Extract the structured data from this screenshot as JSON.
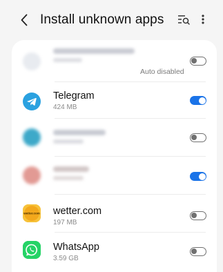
{
  "header": {
    "title": "Install unknown apps",
    "back_icon": "chevron-left-icon",
    "search_icon": "list-search-icon",
    "more_icon": "more-vert-icon"
  },
  "apps": [
    {
      "name": "",
      "size": "",
      "status": "Auto disabled",
      "enabled": false,
      "icon": "blurred-app-icon",
      "blurred": true
    },
    {
      "name": "Telegram",
      "size": "424 MB",
      "status": "",
      "enabled": true,
      "icon": "telegram-icon",
      "blurred": false
    },
    {
      "name": "",
      "size": "",
      "status": "",
      "enabled": false,
      "icon": "blurred-app-icon",
      "blurred": true
    },
    {
      "name": "",
      "size": "",
      "status": "",
      "enabled": true,
      "icon": "blurred-app-icon",
      "blurred": true
    },
    {
      "name": "wetter.com",
      "size": "197 MB",
      "status": "",
      "enabled": false,
      "icon": "wetter-icon",
      "blurred": false,
      "icon_text": "wetter.com"
    },
    {
      "name": "WhatsApp",
      "size": "3.59 GB",
      "status": "",
      "enabled": false,
      "icon": "whatsapp-icon",
      "blurred": false
    }
  ],
  "colors": {
    "accent": "#1a73e8",
    "telegram": "#2aa1e0",
    "whatsapp": "#25d366",
    "wetter": "#f5b82e"
  }
}
